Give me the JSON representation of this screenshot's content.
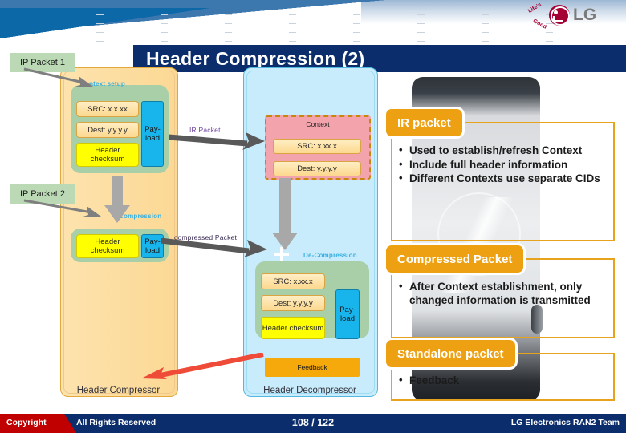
{
  "brand": {
    "logo_text": "LG",
    "tagline_1": "Life's",
    "tagline_2": "Good"
  },
  "slide": {
    "title": "Header Compression (2)"
  },
  "diagram": {
    "left_panel": {
      "caption": "Header Compressor",
      "tag_packet_1": "IP Packet 1",
      "tag_packet_2": "IP Packet 2",
      "group_1": {
        "label": "Context setup",
        "fields": [
          "SRC: x.x.xx",
          "Dest: y.y.y.y",
          "Header checksum"
        ],
        "payload": "Pay-load"
      },
      "group_2": {
        "label": "Compression",
        "fields": [
          "Header checksum"
        ],
        "payload": "Pay-load"
      }
    },
    "mid_panel": {
      "caption": "Header Decompressor",
      "context_box": {
        "label": "Context",
        "fields": [
          "SRC: x.xx.x",
          "Dest: y.y.y.y"
        ]
      },
      "group_decomp": {
        "label": "De-Compression",
        "fields": [
          "SRC: x.xx.x",
          "Dest: y.y.y.y",
          "Header checksum"
        ],
        "payload": "Pay-load"
      },
      "feedback_box": "Feedback"
    },
    "arrows": {
      "ir_packet": "IR Packet",
      "compressed_packet": "compressed Packet"
    }
  },
  "callouts": [
    {
      "header": "IR packet",
      "bullets": [
        "Used to establish/refresh Context",
        "Include full header information",
        "Different Contexts use separate CIDs"
      ]
    },
    {
      "header": "Compressed Packet",
      "bullets": [
        "After Context establishment, only changed information is transmitted"
      ]
    },
    {
      "header": "Standalone packet",
      "bullets": [
        "Feedback"
      ]
    }
  ],
  "footer": {
    "copyright": "Copyright",
    "rights": "All Rights Reserved",
    "page": "108 / 122",
    "team": "LG Electronics RAN2 Team"
  },
  "colors": {
    "title_bar": "#0b2d6b",
    "accent_orange": "#eda011",
    "panel_left": "#fcd894",
    "panel_mid": "#c8ecfb",
    "context_pink": "#f2a3ac",
    "payload_blue": "#18b4ec",
    "checksum_yellow": "#ffff00"
  }
}
